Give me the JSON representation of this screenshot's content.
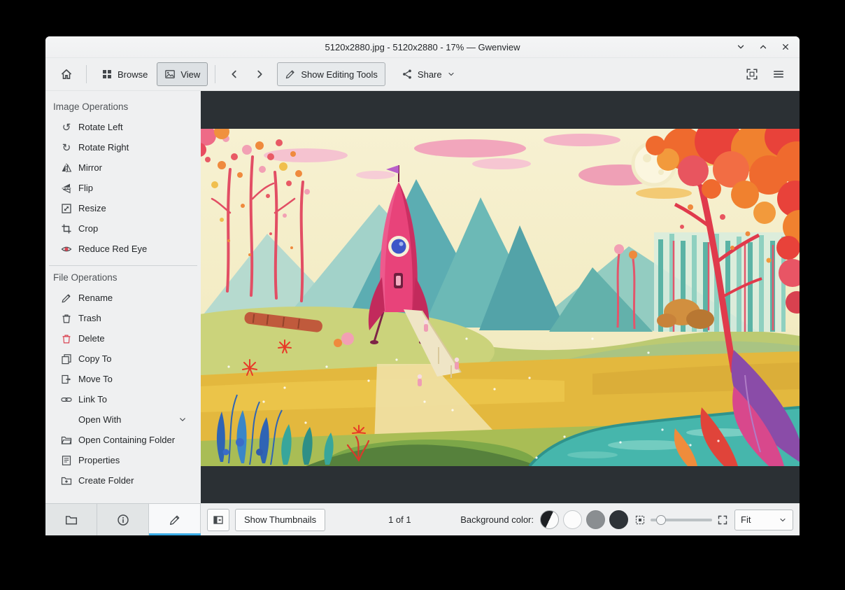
{
  "window": {
    "title": "5120x2880.jpg - 5120x2880 - 17% — Gwenview"
  },
  "toolbar": {
    "browse": "Browse",
    "view": "View",
    "show_editing_tools": "Show Editing Tools",
    "share": "Share"
  },
  "sidebar": {
    "image_operations": {
      "title": "Image Operations",
      "items": [
        {
          "label": "Rotate Left",
          "icon": "rotate-left-icon"
        },
        {
          "label": "Rotate Right",
          "icon": "rotate-right-icon"
        },
        {
          "label": "Mirror",
          "icon": "mirror-icon"
        },
        {
          "label": "Flip",
          "icon": "flip-icon"
        },
        {
          "label": "Resize",
          "icon": "resize-icon"
        },
        {
          "label": "Crop",
          "icon": "crop-icon"
        },
        {
          "label": "Reduce Red Eye",
          "icon": "red-eye-icon"
        }
      ]
    },
    "file_operations": {
      "title": "File Operations",
      "items": [
        {
          "label": "Rename",
          "icon": "rename-icon"
        },
        {
          "label": "Trash",
          "icon": "trash-icon"
        },
        {
          "label": "Delete",
          "icon": "delete-icon"
        },
        {
          "label": "Copy To",
          "icon": "copy-icon"
        },
        {
          "label": "Move To",
          "icon": "move-icon"
        },
        {
          "label": "Link To",
          "icon": "link-icon"
        },
        {
          "label": "Open With",
          "icon": "none"
        },
        {
          "label": "Open Containing Folder",
          "icon": "open-folder-icon"
        },
        {
          "label": "Properties",
          "icon": "properties-icon"
        },
        {
          "label": "Create Folder",
          "icon": "create-folder-icon"
        }
      ]
    }
  },
  "statusbar": {
    "show_thumbnails": "Show Thumbnails",
    "page_indicator": "1 of 1",
    "background_color_label": "Background color:",
    "zoom_mode": "Fit",
    "zoom_slider_position": 0.12,
    "background_options": [
      {
        "name": "half-black-white",
        "colors": [
          "#1d2023",
          "#fbfbfb"
        ]
      },
      {
        "name": "white",
        "colors": [
          "#fcfcfc"
        ]
      },
      {
        "name": "gray",
        "colors": [
          "#8a8e91"
        ]
      },
      {
        "name": "dark",
        "colors": [
          "#2e3338"
        ]
      }
    ]
  },
  "glyphs": {
    "rotate_left": "↺",
    "rotate_right": "↻"
  },
  "colors": {
    "accent": "#3daee9",
    "chrome": "#eff0f1",
    "canvas": "#2b3034",
    "danger": "#da4453",
    "text": "#232629"
  }
}
